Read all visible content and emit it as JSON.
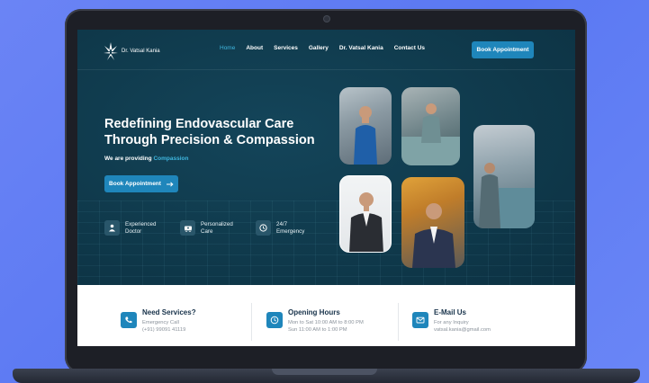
{
  "brand": {
    "name": "Dr. Vatsal Kania",
    "tagline": ""
  },
  "nav": {
    "links": [
      "Home",
      "About",
      "Services",
      "Gallery",
      "Dr. Vatsal Kania",
      "Contact Us"
    ],
    "cta": "Book Appointment"
  },
  "hero": {
    "headline": "Redefining Endovascular Care Through Precision & Compassion",
    "providing_prefix": "We are providing",
    "providing_highlight": "Compassion",
    "cta": "Book Appointment",
    "features": [
      {
        "icon": "doctor-icon",
        "text": "Experienced\nDoctor"
      },
      {
        "icon": "ambulance-icon",
        "text": "Personalized\nCare"
      },
      {
        "icon": "clock-icon",
        "text": "24/7\nEmergency"
      }
    ]
  },
  "info": [
    {
      "icon": "phone-icon",
      "title": "Need Services?",
      "lines": [
        "Emergency Call",
        "(+91) 99091 41119"
      ]
    },
    {
      "icon": "clock-icon",
      "title": "Opening Hours",
      "lines": [
        "Mon to Sat 10:00 AM to 8:00 PM",
        "Sun 11:00 AM to 1:00 PM"
      ]
    },
    {
      "icon": "mail-icon",
      "title": "E-Mail Us",
      "lines": [
        "For any Inquiry",
        "vatsal.kania@gmail.com"
      ]
    }
  ],
  "colors": {
    "accent": "#1f86bb",
    "highlight": "#3fb7e0",
    "hero_bg": "#0f394b",
    "page_bg": "#6b84f5"
  }
}
